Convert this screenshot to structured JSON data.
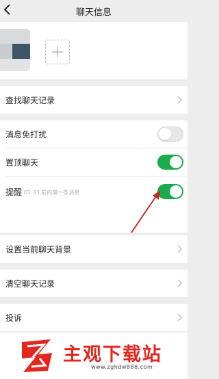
{
  "header": {
    "title": "聊天信息"
  },
  "rows": {
    "search_history": "查找聊天记录",
    "mute": "消息免打扰",
    "pin": "置顶聊天",
    "remind": "提醒",
    "remind_hint": "将提醒:01:33 前的第一条消息",
    "background": "设置当前聊天背景",
    "clear": "清空聊天记录",
    "report": "投诉"
  },
  "toggles": {
    "mute_on": false,
    "pin_on": true,
    "remind_on": true
  },
  "colors": {
    "toggle_on": "#19ac4a",
    "accent_red": "#e5261f"
  },
  "icons": {
    "back": "chevron-left-icon",
    "add": "plus-icon",
    "row": "chevron-right-icon"
  },
  "watermark": {
    "brand": "主观下载站",
    "url": "www.zghdw888.com"
  }
}
